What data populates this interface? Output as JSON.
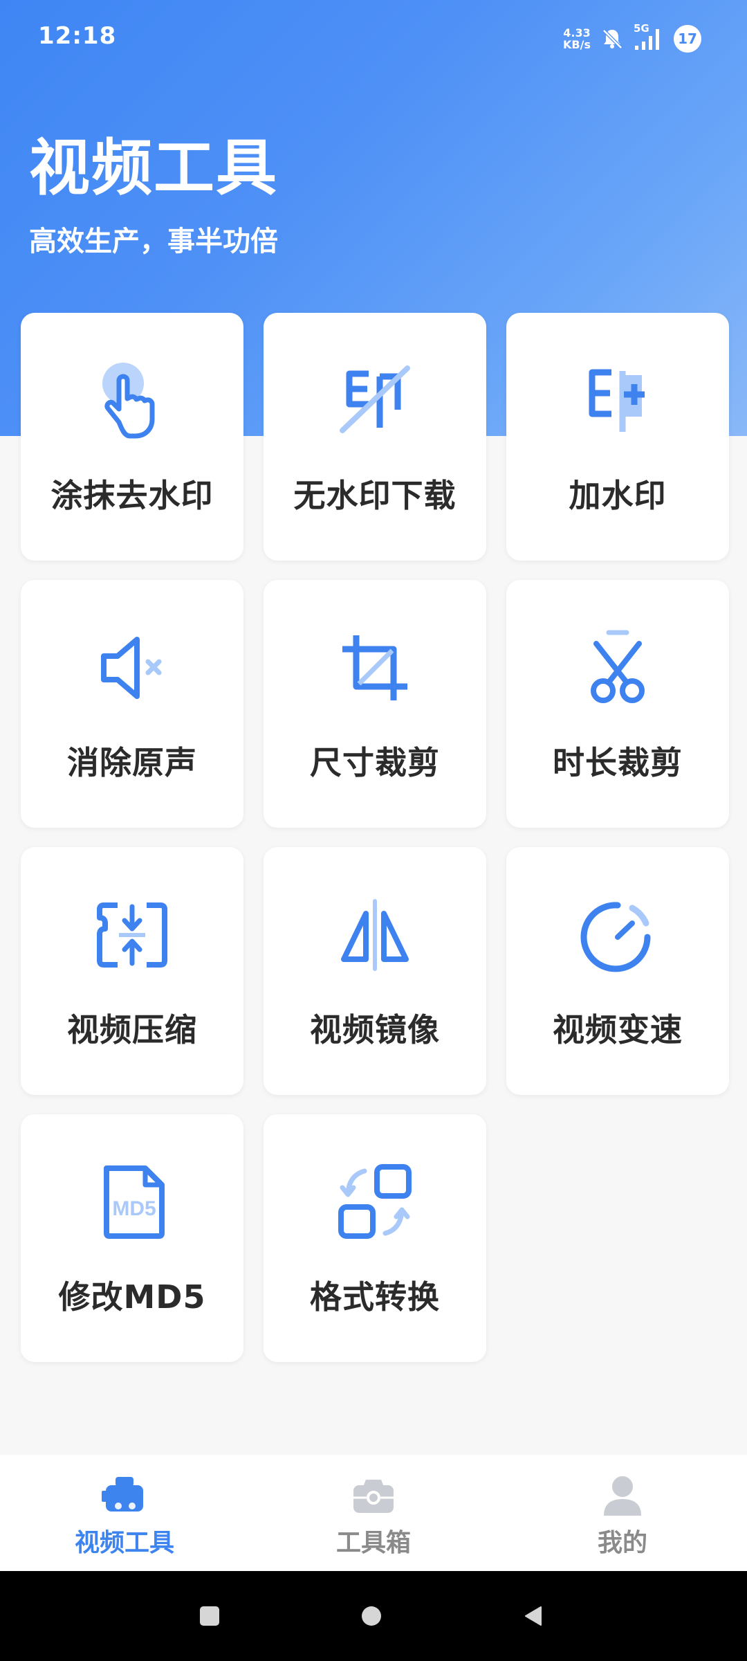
{
  "status_bar": {
    "time": "12:18",
    "net_speed_value": "4.33",
    "net_speed_unit": "KB/s",
    "network_type": "5G",
    "battery": "17"
  },
  "header": {
    "title": "视频工具",
    "subtitle": "高效生产，事半功倍"
  },
  "tools": [
    {
      "label": "涂抹去水印",
      "icon": "tap-finger-icon"
    },
    {
      "label": "无水印下载",
      "icon": "watermark-off-icon"
    },
    {
      "label": "加水印",
      "icon": "watermark-add-icon"
    },
    {
      "label": "消除原声",
      "icon": "volume-mute-icon"
    },
    {
      "label": "尺寸裁剪",
      "icon": "crop-icon"
    },
    {
      "label": "时长裁剪",
      "icon": "scissors-icon"
    },
    {
      "label": "视频压缩",
      "icon": "compress-icon"
    },
    {
      "label": "视频镜像",
      "icon": "mirror-icon"
    },
    {
      "label": "视频变速",
      "icon": "speed-gauge-icon"
    },
    {
      "label": "修改MD5",
      "icon": "md5-file-icon",
      "icon_text": "MD5"
    },
    {
      "label": "格式转换",
      "icon": "format-convert-icon"
    }
  ],
  "bottom_nav": [
    {
      "label": "视频工具",
      "icon": "video-tools-icon",
      "active": true
    },
    {
      "label": "工具箱",
      "icon": "toolbox-icon",
      "active": false
    },
    {
      "label": "我的",
      "icon": "profile-icon",
      "active": false
    }
  ],
  "colors": {
    "accent": "#3e84ee",
    "icon_blue": "#3d82ee",
    "icon_light": "#a9c9fb",
    "header_gradient_start": "#3f86f4",
    "header_gradient_end": "#8ab8f8",
    "nav_inactive": "#8a8a8a"
  }
}
